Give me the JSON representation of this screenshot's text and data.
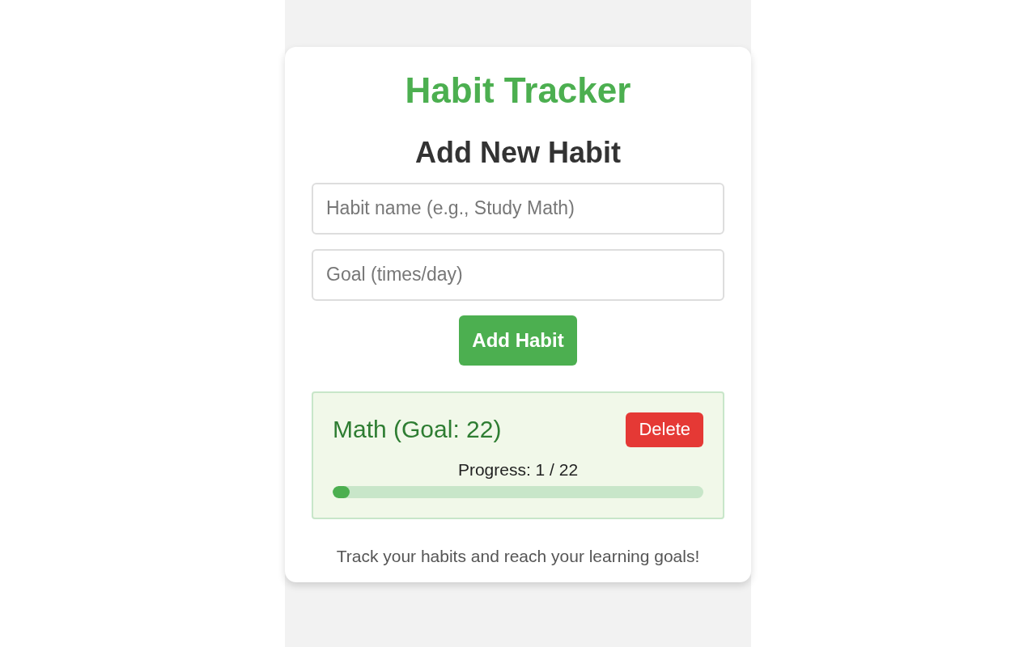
{
  "app": {
    "title": "Habit Tracker"
  },
  "form": {
    "heading": "Add New Habit",
    "name_field": {
      "placeholder": "Habit name (e.g., Study Math)"
    },
    "goal_field": {
      "placeholder": "Goal (times/day)"
    },
    "button": "Add Habit"
  },
  "habits": [
    {
      "name": "Math (Goal: 22)",
      "delete": "Delete",
      "progress": "Progress: 1 / 22",
      "level": 0.045
    }
  ],
  "footer": "Track your habits and reach your learning goals!"
}
